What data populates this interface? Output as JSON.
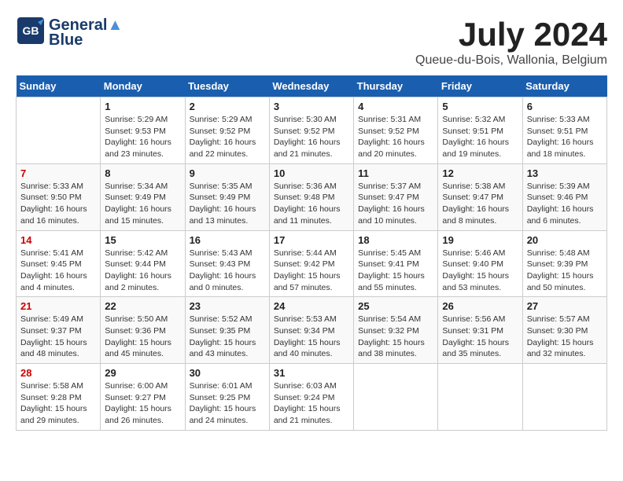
{
  "header": {
    "logo_line1": "General",
    "logo_line2": "Blue",
    "month": "July 2024",
    "location": "Queue-du-Bois, Wallonia, Belgium"
  },
  "weekdays": [
    "Sunday",
    "Monday",
    "Tuesday",
    "Wednesday",
    "Thursday",
    "Friday",
    "Saturday"
  ],
  "weeks": [
    [
      {
        "day": "",
        "info": ""
      },
      {
        "day": "1",
        "info": "Sunrise: 5:29 AM\nSunset: 9:53 PM\nDaylight: 16 hours\nand 23 minutes."
      },
      {
        "day": "2",
        "info": "Sunrise: 5:29 AM\nSunset: 9:52 PM\nDaylight: 16 hours\nand 22 minutes."
      },
      {
        "day": "3",
        "info": "Sunrise: 5:30 AM\nSunset: 9:52 PM\nDaylight: 16 hours\nand 21 minutes."
      },
      {
        "day": "4",
        "info": "Sunrise: 5:31 AM\nSunset: 9:52 PM\nDaylight: 16 hours\nand 20 minutes."
      },
      {
        "day": "5",
        "info": "Sunrise: 5:32 AM\nSunset: 9:51 PM\nDaylight: 16 hours\nand 19 minutes."
      },
      {
        "day": "6",
        "info": "Sunrise: 5:33 AM\nSunset: 9:51 PM\nDaylight: 16 hours\nand 18 minutes."
      }
    ],
    [
      {
        "day": "7",
        "info": "Sunrise: 5:33 AM\nSunset: 9:50 PM\nDaylight: 16 hours\nand 16 minutes."
      },
      {
        "day": "8",
        "info": "Sunrise: 5:34 AM\nSunset: 9:49 PM\nDaylight: 16 hours\nand 15 minutes."
      },
      {
        "day": "9",
        "info": "Sunrise: 5:35 AM\nSunset: 9:49 PM\nDaylight: 16 hours\nand 13 minutes."
      },
      {
        "day": "10",
        "info": "Sunrise: 5:36 AM\nSunset: 9:48 PM\nDaylight: 16 hours\nand 11 minutes."
      },
      {
        "day": "11",
        "info": "Sunrise: 5:37 AM\nSunset: 9:47 PM\nDaylight: 16 hours\nand 10 minutes."
      },
      {
        "day": "12",
        "info": "Sunrise: 5:38 AM\nSunset: 9:47 PM\nDaylight: 16 hours\nand 8 minutes."
      },
      {
        "day": "13",
        "info": "Sunrise: 5:39 AM\nSunset: 9:46 PM\nDaylight: 16 hours\nand 6 minutes."
      }
    ],
    [
      {
        "day": "14",
        "info": "Sunrise: 5:41 AM\nSunset: 9:45 PM\nDaylight: 16 hours\nand 4 minutes."
      },
      {
        "day": "15",
        "info": "Sunrise: 5:42 AM\nSunset: 9:44 PM\nDaylight: 16 hours\nand 2 minutes."
      },
      {
        "day": "16",
        "info": "Sunrise: 5:43 AM\nSunset: 9:43 PM\nDaylight: 16 hours\nand 0 minutes."
      },
      {
        "day": "17",
        "info": "Sunrise: 5:44 AM\nSunset: 9:42 PM\nDaylight: 15 hours\nand 57 minutes."
      },
      {
        "day": "18",
        "info": "Sunrise: 5:45 AM\nSunset: 9:41 PM\nDaylight: 15 hours\nand 55 minutes."
      },
      {
        "day": "19",
        "info": "Sunrise: 5:46 AM\nSunset: 9:40 PM\nDaylight: 15 hours\nand 53 minutes."
      },
      {
        "day": "20",
        "info": "Sunrise: 5:48 AM\nSunset: 9:39 PM\nDaylight: 15 hours\nand 50 minutes."
      }
    ],
    [
      {
        "day": "21",
        "info": "Sunrise: 5:49 AM\nSunset: 9:37 PM\nDaylight: 15 hours\nand 48 minutes."
      },
      {
        "day": "22",
        "info": "Sunrise: 5:50 AM\nSunset: 9:36 PM\nDaylight: 15 hours\nand 45 minutes."
      },
      {
        "day": "23",
        "info": "Sunrise: 5:52 AM\nSunset: 9:35 PM\nDaylight: 15 hours\nand 43 minutes."
      },
      {
        "day": "24",
        "info": "Sunrise: 5:53 AM\nSunset: 9:34 PM\nDaylight: 15 hours\nand 40 minutes."
      },
      {
        "day": "25",
        "info": "Sunrise: 5:54 AM\nSunset: 9:32 PM\nDaylight: 15 hours\nand 38 minutes."
      },
      {
        "day": "26",
        "info": "Sunrise: 5:56 AM\nSunset: 9:31 PM\nDaylight: 15 hours\nand 35 minutes."
      },
      {
        "day": "27",
        "info": "Sunrise: 5:57 AM\nSunset: 9:30 PM\nDaylight: 15 hours\nand 32 minutes."
      }
    ],
    [
      {
        "day": "28",
        "info": "Sunrise: 5:58 AM\nSunset: 9:28 PM\nDaylight: 15 hours\nand 29 minutes."
      },
      {
        "day": "29",
        "info": "Sunrise: 6:00 AM\nSunset: 9:27 PM\nDaylight: 15 hours\nand 26 minutes."
      },
      {
        "day": "30",
        "info": "Sunrise: 6:01 AM\nSunset: 9:25 PM\nDaylight: 15 hours\nand 24 minutes."
      },
      {
        "day": "31",
        "info": "Sunrise: 6:03 AM\nSunset: 9:24 PM\nDaylight: 15 hours\nand 21 minutes."
      },
      {
        "day": "",
        "info": ""
      },
      {
        "day": "",
        "info": ""
      },
      {
        "day": "",
        "info": ""
      }
    ]
  ]
}
